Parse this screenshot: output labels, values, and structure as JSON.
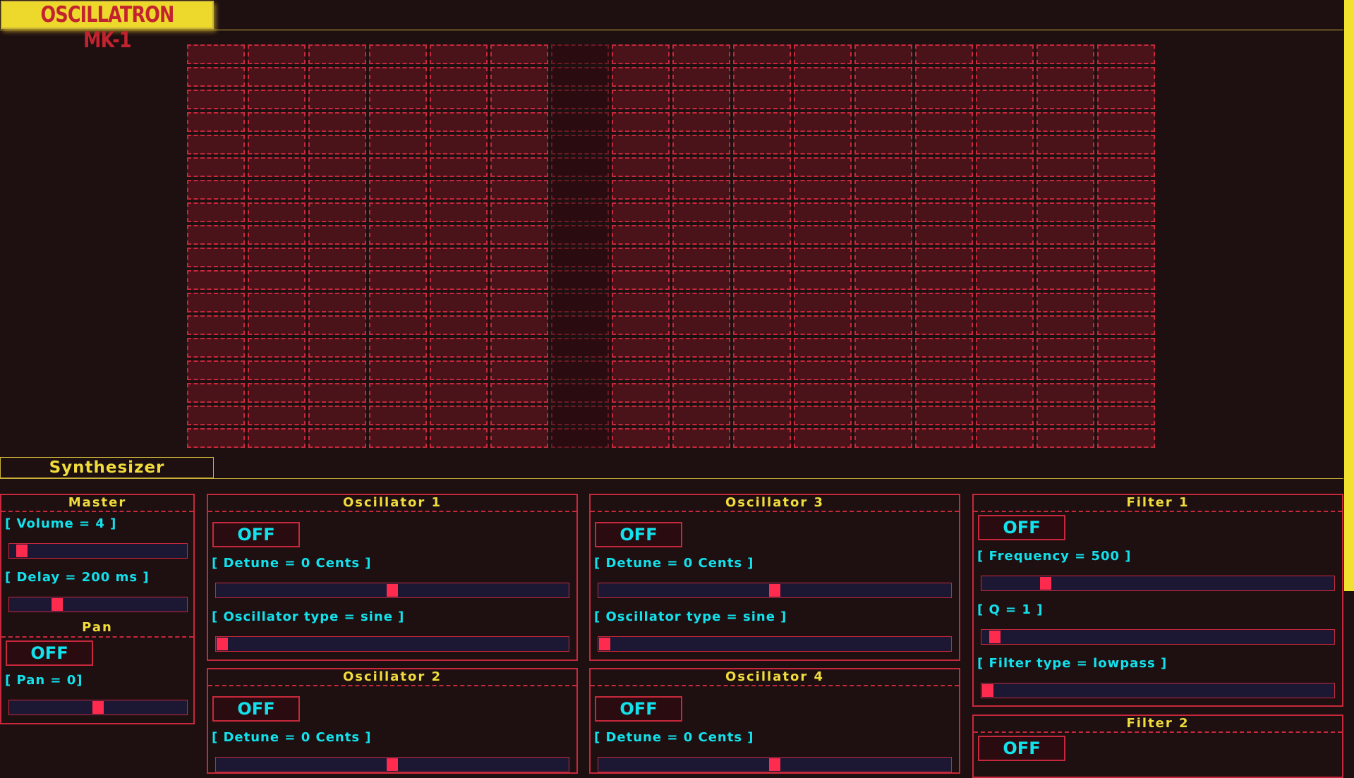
{
  "app": {
    "title": "OSCILLATRON MK-1"
  },
  "sequencer": {
    "columns": 16,
    "rows": 18,
    "dim_column": 7
  },
  "synth_section": {
    "title": "Synthesizer"
  },
  "master": {
    "title": "Master",
    "volume_label": "[ Volume = 4 ]",
    "volume_value": 0.04,
    "delay_label": "[ Delay = 200 ms ]",
    "delay_value": 0.25,
    "pan_title": "Pan",
    "pan_toggle": "OFF",
    "pan_label": "[ Pan = 0]",
    "pan_value": 0.5
  },
  "osc1": {
    "title": "Oscillator 1",
    "toggle": "OFF",
    "detune_label": "[ Detune = 0 Cents ]",
    "detune_value": 0.5,
    "type_label": "[ Oscillator type = sine ]",
    "type_value": 0.0
  },
  "osc2": {
    "title": "Oscillator 2",
    "toggle": "OFF",
    "detune_label": "[ Detune = 0 Cents ]",
    "detune_value": 0.5
  },
  "osc3": {
    "title": "Oscillator 3",
    "toggle": "OFF",
    "detune_label": "[ Detune = 0 Cents ]",
    "detune_value": 0.5,
    "type_label": "[ Oscillator type = sine ]",
    "type_value": 0.0
  },
  "osc4": {
    "title": "Oscillator 4",
    "toggle": "OFF",
    "detune_label": "[ Detune = 0 Cents ]",
    "detune_value": 0.5
  },
  "filter1": {
    "title": "Filter 1",
    "toggle": "OFF",
    "freq_label": "[ Frequency = 500 ]",
    "freq_value": 0.17,
    "q_label": "[ Q = 1 ]",
    "q_value": 0.02,
    "type_label": "[ Filter type = lowpass ]",
    "type_value": 0.0
  },
  "filter2": {
    "title": "Filter 2",
    "toggle": "OFF"
  },
  "colors": {
    "background": "#1e0f11",
    "accent_red": "#c8283b",
    "thumb": "#ff2b4e",
    "cyan_text": "#12e2ec",
    "yellow": "#f0dd3c"
  }
}
